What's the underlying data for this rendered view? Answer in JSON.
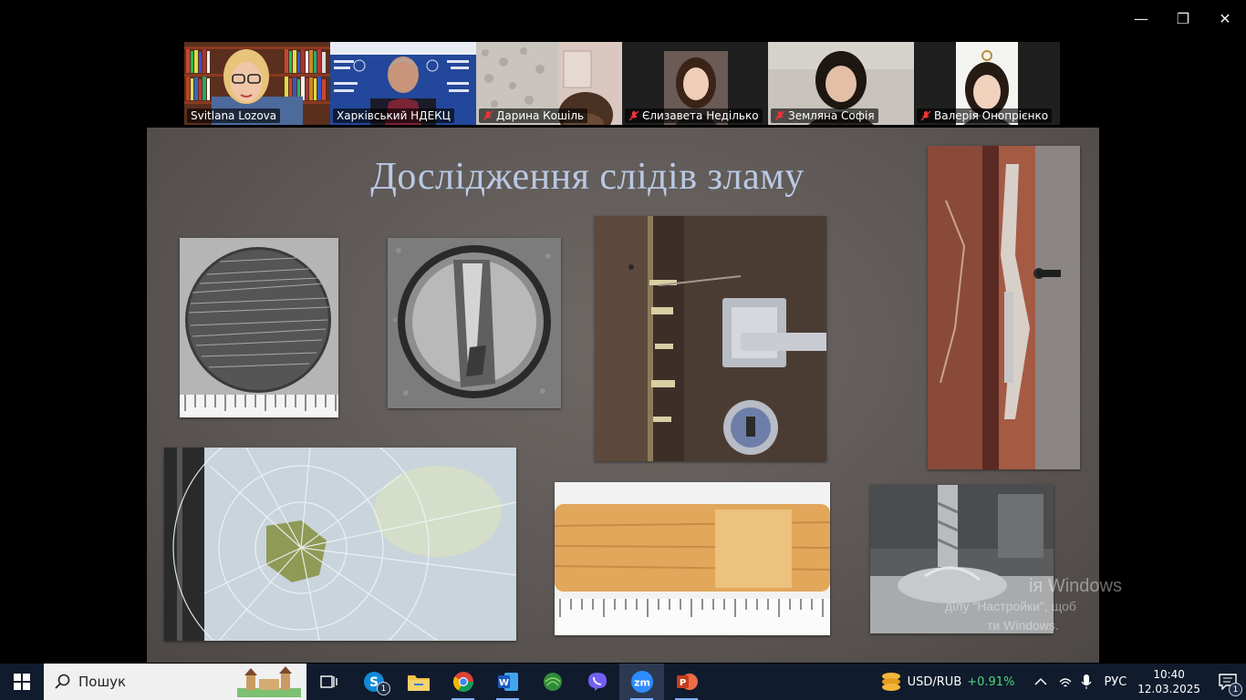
{
  "window": {
    "minimize_glyph": "—",
    "maximize_glyph": "❐",
    "close_glyph": "✕"
  },
  "participants": [
    {
      "name": "Svitlana Lozova",
      "muted": false,
      "active": false
    },
    {
      "name": "Харківський НДЕКЦ",
      "muted": false,
      "active": true
    },
    {
      "name": "Дарина Кошіль",
      "muted": true,
      "active": false
    },
    {
      "name": "Єлизавета Неділько",
      "muted": true,
      "active": false
    },
    {
      "name": "Земляна Софія",
      "muted": true,
      "active": false
    },
    {
      "name": "Валерія Онопрієнко",
      "muted": true,
      "active": false
    }
  ],
  "slide": {
    "title": "Дослідження слідів зламу"
  },
  "watermark": {
    "line1": "ія Windows",
    "line2": "ділу \"Настройки\", щоб",
    "line3": "ти Windows."
  },
  "taskbar": {
    "search_label": "Пошук",
    "skype_badge": "1",
    "ticker_label": "USD/RUB",
    "ticker_change": "+0.91%",
    "language": "РУС",
    "time": "10:40",
    "date": "12.03.2025",
    "notification_count": "1",
    "colors": {
      "accent_green": "#4fd67b",
      "active_border": "#22d05a"
    }
  }
}
